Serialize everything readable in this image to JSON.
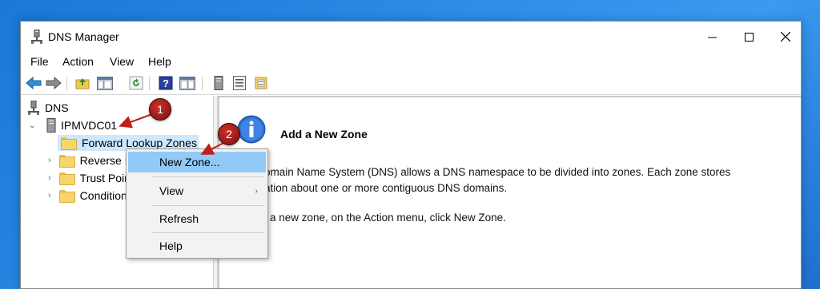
{
  "window": {
    "title": "DNS Manager",
    "controls": {
      "minimize": "—",
      "maximize": "☐",
      "close": "✕"
    }
  },
  "menubar": {
    "items": [
      "File",
      "Action",
      "View",
      "Help"
    ]
  },
  "toolbar": {
    "buttons": [
      "back-arrow-icon",
      "forward-arrow-icon",
      "up-folder-icon",
      "show-hide-console-tree-icon",
      "refresh-icon",
      "help-icon",
      "properties-icon",
      "server-icon",
      "list-icon",
      "zone-icon"
    ]
  },
  "tree": {
    "root": "DNS",
    "server": "IPMVDC01",
    "children": [
      "Forward Lookup Zones",
      "Reverse Lookup Zones",
      "Trust Points",
      "Conditional Forwarders"
    ]
  },
  "context_menu": {
    "items": [
      {
        "label": "New Zone...",
        "highlighted": true
      },
      {
        "label": "View",
        "submenu": true
      },
      {
        "label": "Refresh"
      },
      {
        "label": "Help"
      }
    ]
  },
  "info_panel": {
    "heading": "Add a New Zone",
    "line1": "omain Name System (DNS) allows a DNS namespace to be divided into zones. Each zone stores",
    "line2": "ation about one or more contiguous DNS domains.",
    "line3": "a new zone, on the Action menu, click New Zone."
  },
  "annotations": {
    "badge1": "1",
    "badge2": "2"
  },
  "colors": {
    "accent": "#91c9f7",
    "badge": "#a61f1b",
    "desktop": "#2b8be6"
  }
}
